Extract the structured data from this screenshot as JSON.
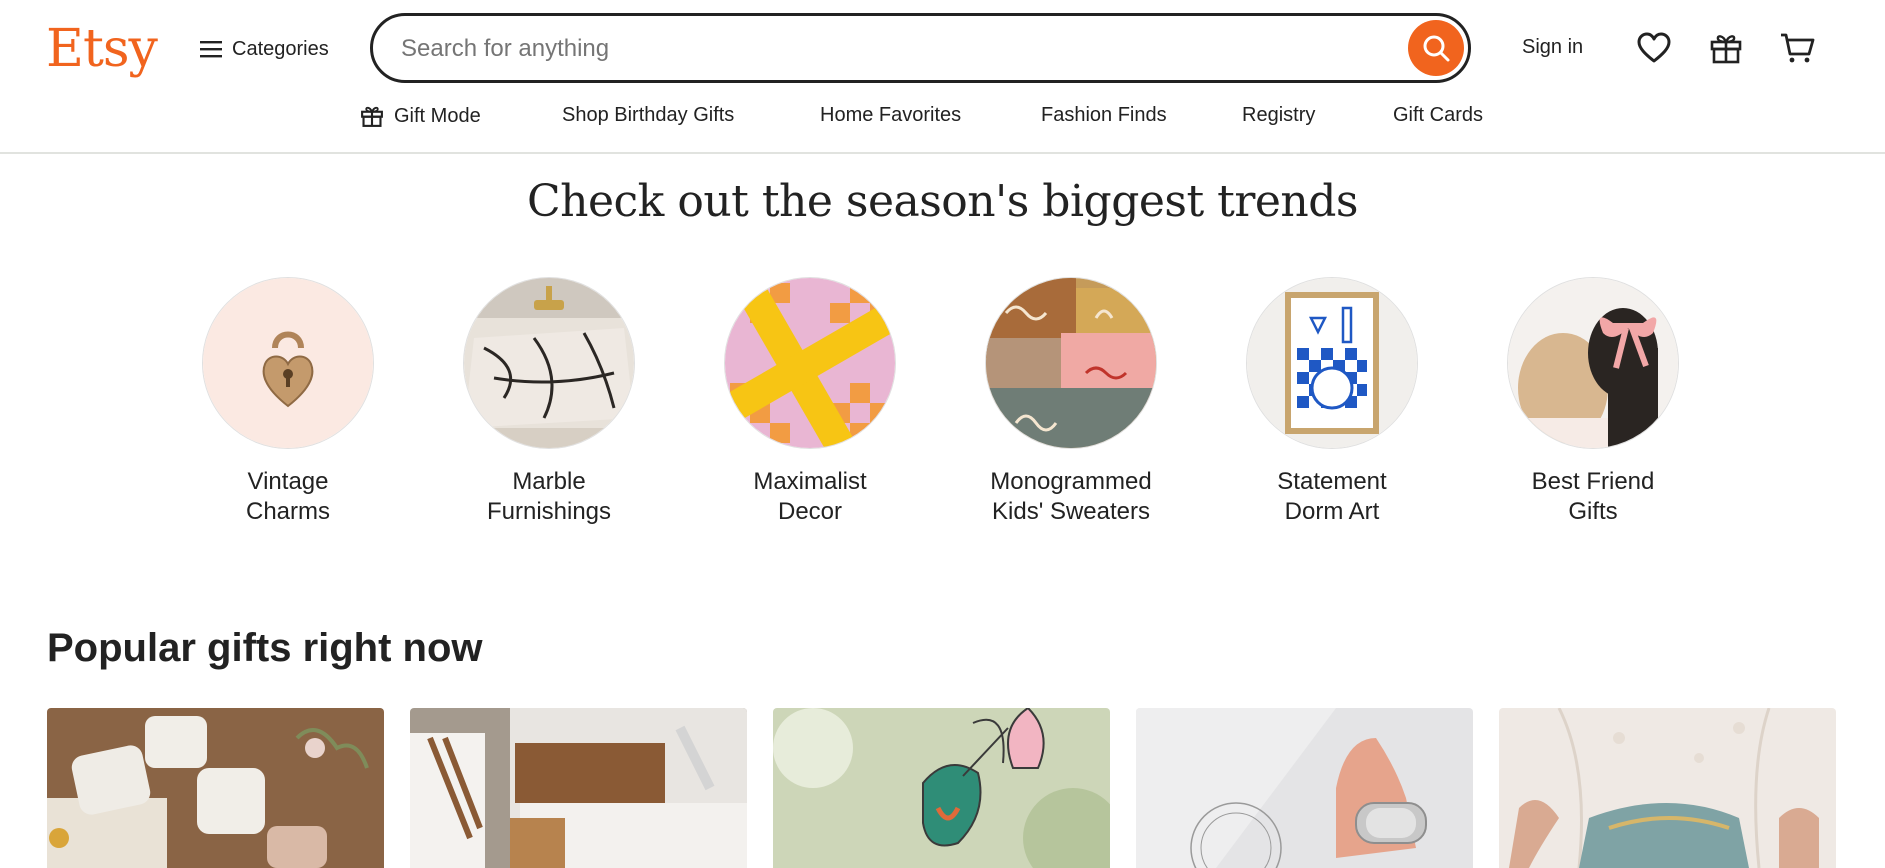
{
  "header": {
    "logo": "Etsy",
    "categories_label": "Categories",
    "search_placeholder": "Search for anything",
    "signin_label": "Sign in",
    "icons": [
      "menu-icon",
      "search-icon",
      "heart-icon",
      "gift-icon",
      "cart-icon"
    ],
    "brand_color": "#F1641E"
  },
  "subnav": [
    {
      "label": "Gift Mode",
      "icon": "gift-icon"
    },
    {
      "label": "Shop Birthday Gifts"
    },
    {
      "label": "Home Favorites"
    },
    {
      "label": "Fashion Finds"
    },
    {
      "label": "Registry"
    },
    {
      "label": "Gift Cards"
    }
  ],
  "trends": {
    "title": "Check out the season's biggest trends",
    "items": [
      {
        "line1": "Vintage",
        "line2": "Charms"
      },
      {
        "line1": "Marble",
        "line2": "Furnishings"
      },
      {
        "line1": "Maximalist",
        "line2": "Decor"
      },
      {
        "line1": "Monogrammed",
        "line2": "Kids' Sweaters"
      },
      {
        "line1": "Statement",
        "line2": "Dorm Art"
      },
      {
        "line1": "Best Friend",
        "line2": "Gifts"
      }
    ]
  },
  "popular": {
    "title": "Popular gifts right now"
  }
}
